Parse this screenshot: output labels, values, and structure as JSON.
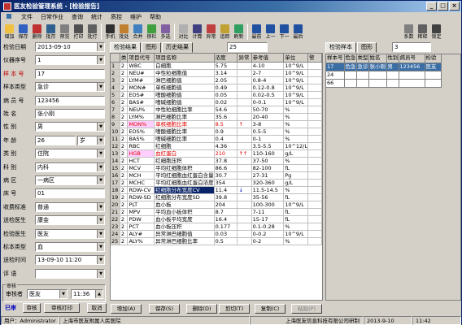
{
  "window": {
    "title": "医友检验管理系统 - [检验报告]",
    "controls": [
      "_",
      "□",
      "×"
    ]
  },
  "menu": [
    "文件",
    "日常作业",
    "查询",
    "统计",
    "质控",
    "维护",
    "帮助"
  ],
  "toolbar_main": [
    {
      "label": "增加",
      "icon": "add-icon",
      "color": "#f0c040"
    },
    {
      "label": "保存",
      "icon": "save-icon",
      "color": "#3060c0"
    },
    {
      "label": "删除",
      "icon": "delete-icon",
      "color": "#c03030"
    },
    {
      "label": "批存",
      "icon": "batch-save-icon",
      "color": "#306090"
    },
    {
      "label": "预览",
      "icon": "preview-icon",
      "color": "#808080"
    },
    {
      "label": "打印",
      "icon": "print-icon",
      "color": "#505050"
    },
    {
      "label": "批打",
      "icon": "batch-print-icon",
      "color": "#606060"
    },
    {
      "label": "手机",
      "icon": "phone-icon",
      "color": "#303030"
    },
    {
      "label": "批处",
      "icon": "batch-process-icon",
      "color": "#c08030"
    },
    {
      "label": "合并",
      "icon": "merge-icon",
      "color": "#4080c0"
    },
    {
      "label": "移栏",
      "icon": "move-column-icon",
      "color": "#40a040"
    },
    {
      "label": "多选",
      "icon": "multi-select-icon",
      "color": "#8060a0"
    },
    {
      "label": "对比",
      "icon": "compare-icon",
      "color": "#b0b0b0"
    },
    {
      "label": "计算",
      "icon": "calculate-icon",
      "color": "#404080"
    },
    {
      "label": "异常",
      "icon": "abnormal-icon",
      "color": "#c04040"
    },
    {
      "label": "追踪",
      "icon": "track-icon",
      "color": "#c0a030"
    },
    {
      "label": "刷新",
      "icon": "refresh-icon",
      "color": "#30a060"
    },
    {
      "label": "最前",
      "icon": "first-icon",
      "color": "#2050a0"
    },
    {
      "label": "上一",
      "icon": "prev-icon",
      "color": "#2050a0"
    },
    {
      "label": "下一",
      "icon": "next-icon",
      "color": "#2050a0"
    },
    {
      "label": "最后",
      "icon": "last-icon",
      "color": "#2050a0"
    }
  ],
  "toolbar_right": [
    {
      "label": "系数",
      "icon": "coefficient-icon",
      "color": "#808080"
    },
    {
      "label": "稀释",
      "icon": "dilute-icon",
      "color": "#606060"
    },
    {
      "label": "锁定",
      "icon": "lock-icon",
      "color": "#404040"
    }
  ],
  "form": [
    {
      "label": "检验日期",
      "value": "2013-09-10",
      "dropdown": true,
      "red": false
    },
    {
      "label": "仪器序号",
      "value": "1",
      "dropdown": true,
      "red": false
    },
    {
      "label": "样 本 号",
      "value": "17",
      "dropdown": false,
      "red": true
    },
    {
      "label": "样本类型",
      "value": "急诊",
      "dropdown": true,
      "red": false
    },
    {
      "label": "病 员 号",
      "value": "123456",
      "dropdown": false,
      "red": false
    },
    {
      "label": "姓    名",
      "value": "张小刚",
      "dropdown": false,
      "red": false
    },
    {
      "label": "性    别",
      "value": "男",
      "dropdown": true,
      "red": false
    },
    {
      "label": "年    龄",
      "value": "26",
      "dropdown": false,
      "red": false,
      "unit": "岁"
    },
    {
      "label": "类    别",
      "value": "住院",
      "dropdown": true,
      "red": false
    },
    {
      "label": "科    别",
      "value": "内科",
      "dropdown": true,
      "red": false
    },
    {
      "label": "病    区",
      "value": "一病区",
      "dropdown": true,
      "red": false
    },
    {
      "label": "床    号",
      "value": "01",
      "dropdown": false,
      "red": false
    },
    {
      "label": "收费标准",
      "value": "普通",
      "dropdown": true,
      "red": false
    },
    {
      "label": "送检医生",
      "value": "康金",
      "dropdown": true,
      "red": false
    },
    {
      "label": "检验医生",
      "value": "医友",
      "dropdown": true,
      "red": false
    },
    {
      "label": "标本类型",
      "value": "血",
      "dropdown": true,
      "red": false
    },
    {
      "label": "送检时间",
      "value": "13-09-10 11:20",
      "dropdown": true,
      "red": false
    },
    {
      "label": "评    语",
      "value": "",
      "dropdown": true,
      "red": false
    }
  ],
  "review": {
    "group": "审核",
    "label": "审核者",
    "reviewer": "医友",
    "time": "11:36"
  },
  "left_actions": {
    "status": "已审",
    "audit": "审核",
    "audit_print": "审核打印",
    "cancel": "取消"
  },
  "mid_tabs": [
    {
      "label": "检验结果",
      "active": true
    },
    {
      "label": "图形",
      "active": false
    },
    {
      "label": "历史结果",
      "active": false
    }
  ],
  "mid_count": "25",
  "grid_columns": [
    "",
    "类",
    "项目代号",
    "项目名称",
    "浓度",
    "异常",
    "参考值",
    "单位",
    "警"
  ],
  "grid_rows": [
    {
      "n": "1",
      "t": "2",
      "code": "WBC",
      "name": "白细胞",
      "val": "5.75",
      "flag": "",
      "ref": "4-10",
      "unit": "10^9/L",
      "red": false
    },
    {
      "n": "2",
      "t": "2",
      "code": "NEU#",
      "name": "中性粒细胞值",
      "val": "3.14",
      "flag": "",
      "ref": "2-7",
      "unit": "10^9/L",
      "red": false
    },
    {
      "n": "3",
      "t": "2",
      "code": "LYM#",
      "name": "淋巴细胞值",
      "val": "2.05",
      "flag": "",
      "ref": "0.8-4",
      "unit": "10^9/L",
      "red": false
    },
    {
      "n": "4",
      "t": "2",
      "code": "MON#",
      "name": "单核细胞值",
      "val": "0.49",
      "flag": "",
      "ref": "0.12-0.8",
      "unit": "10^9/L",
      "red": false
    },
    {
      "n": "5",
      "t": "2",
      "code": "EOS#",
      "name": "嗜酸细胞值",
      "val": "0.05",
      "flag": "",
      "ref": "0.02-0.5",
      "unit": "10^9/L",
      "red": false
    },
    {
      "n": "6",
      "t": "2",
      "code": "BAS#",
      "name": "嗜碱细胞值",
      "val": "0.02",
      "flag": "",
      "ref": "0-0.1",
      "unit": "10^9/L",
      "red": false
    },
    {
      "n": "7",
      "t": "2",
      "code": "NEU%",
      "name": "中性粒细胞比率",
      "val": "54.6",
      "flag": "",
      "ref": "50-70",
      "unit": "%",
      "red": false
    },
    {
      "n": "8",
      "t": "2",
      "code": "LYM%",
      "name": "淋巴细胞比率",
      "val": "35.6",
      "flag": "",
      "ref": "20-40",
      "unit": "%",
      "red": false
    },
    {
      "n": "9",
      "t": "2",
      "code": "MON%",
      "name": "单核细胞比率",
      "val": "8.5",
      "flag": "↑",
      "ref": "3-8",
      "unit": "%",
      "red": true
    },
    {
      "n": "10",
      "t": "2",
      "code": "EOS%",
      "name": "嗜酸细胞比率",
      "val": "0.9",
      "flag": "",
      "ref": "0.5-5",
      "unit": "%",
      "red": false
    },
    {
      "n": "11",
      "t": "2",
      "code": "BAS%",
      "name": "嗜碱细胞比率",
      "val": "0.4",
      "flag": "",
      "ref": "0-1",
      "unit": "%",
      "red": false
    },
    {
      "n": "12",
      "t": "2",
      "code": "RBC",
      "name": "红细胞",
      "val": "4.36",
      "flag": "",
      "ref": "3.5-5.5",
      "unit": "10^12/L",
      "red": false
    },
    {
      "n": "13",
      "t": "2",
      "code": "HGB",
      "name": "血红蛋白",
      "val": "210",
      "flag": "↑↑",
      "ref": "110-160",
      "unit": "g/L",
      "red": true
    },
    {
      "n": "14",
      "t": "2",
      "code": "HCT",
      "name": "红细胞压积",
      "val": "37.8",
      "flag": "",
      "ref": "37-50",
      "unit": "%",
      "red": false
    },
    {
      "n": "15",
      "t": "2",
      "code": "MCV",
      "name": "平均红细胞体积",
      "val": "86.6",
      "flag": "",
      "ref": "82-100",
      "unit": "fL",
      "red": false
    },
    {
      "n": "16",
      "t": "2",
      "code": "MCH",
      "name": "平均红细胞血红蛋白含量",
      "val": "30.7",
      "flag": "",
      "ref": "27-31",
      "unit": "Pg",
      "red": false
    },
    {
      "n": "17",
      "t": "2",
      "code": "MCHC",
      "name": "平均红细胞血红蛋白浓度",
      "val": "354",
      "flag": "",
      "ref": "320-360",
      "unit": "g/L",
      "red": false
    },
    {
      "n": "18",
      "t": "2",
      "code": "RDW-CV",
      "name": "红细胞分布宽度CV",
      "val": "11.4",
      "flag": "↓",
      "ref": "11.5-14.5",
      "unit": "%",
      "blue": true
    },
    {
      "n": "19",
      "t": "2",
      "code": "RDW-SD",
      "name": "红细胞分布宽度SD",
      "val": "39.8",
      "flag": "",
      "ref": "35-56",
      "unit": "fL",
      "red": false
    },
    {
      "n": "20",
      "t": "2",
      "code": "PLT",
      "name": "血小板",
      "val": "204",
      "flag": "",
      "ref": "100-300",
      "unit": "10^9/L",
      "red": false
    },
    {
      "n": "21",
      "t": "2",
      "code": "MPV",
      "name": "平均血小板体积",
      "val": "8.7",
      "flag": "",
      "ref": "7-11",
      "unit": "fL",
      "red": false
    },
    {
      "n": "22",
      "t": "2",
      "code": "PDW",
      "name": "血小板平均宽度",
      "val": "16.4",
      "flag": "",
      "ref": "15-17",
      "unit": "fL",
      "red": false
    },
    {
      "n": "23",
      "t": "2",
      "code": "PCT",
      "name": "血小板压积",
      "val": "0.177",
      "flag": "",
      "ref": "0.1-0.28",
      "unit": "%",
      "red": false
    },
    {
      "n": "24",
      "t": "2",
      "code": "ALY#",
      "name": "异常淋巴细胞值",
      "val": "0.03",
      "flag": "",
      "ref": "0-0.2",
      "unit": "10^9/L",
      "red": false
    },
    {
      "n": "25",
      "t": "2",
      "code": "ALY%",
      "name": "异常淋巴细胞比率",
      "val": "0.5",
      "flag": "",
      "ref": "0-2",
      "unit": "%",
      "red": false
    }
  ],
  "right_tabs": [
    {
      "label": "检验样本",
      "active": true
    },
    {
      "label": "图形",
      "active": false
    }
  ],
  "right_count": "3",
  "right_columns": [
    "样本号",
    "危急",
    "类型",
    "姓名",
    "性别",
    "病员号",
    "检验"
  ],
  "right_rows": [
    {
      "cells": [
        "17",
        "危急",
        "急诊",
        "张小刚",
        "男",
        "123456",
        "医友"
      ],
      "hl": true
    },
    {
      "cells": [
        "24",
        "",
        "",
        "",
        "",
        "",
        ""
      ],
      "hl": false
    },
    {
      "cells": [
        "66",
        "",
        "",
        "",
        "",
        "",
        ""
      ],
      "hl": false
    }
  ],
  "mid_actions": [
    "增加(A)",
    "保存(S)",
    "删除(D)",
    "剪切(T)",
    "复制(C)",
    "粘贴(P)"
  ],
  "status": {
    "user": "用户：Administrator",
    "hospital": "上海市医友附属人民医院",
    "company": "上海医友信息科技有限公司研制",
    "date": "2013-9-10",
    "time": "11:42"
  }
}
